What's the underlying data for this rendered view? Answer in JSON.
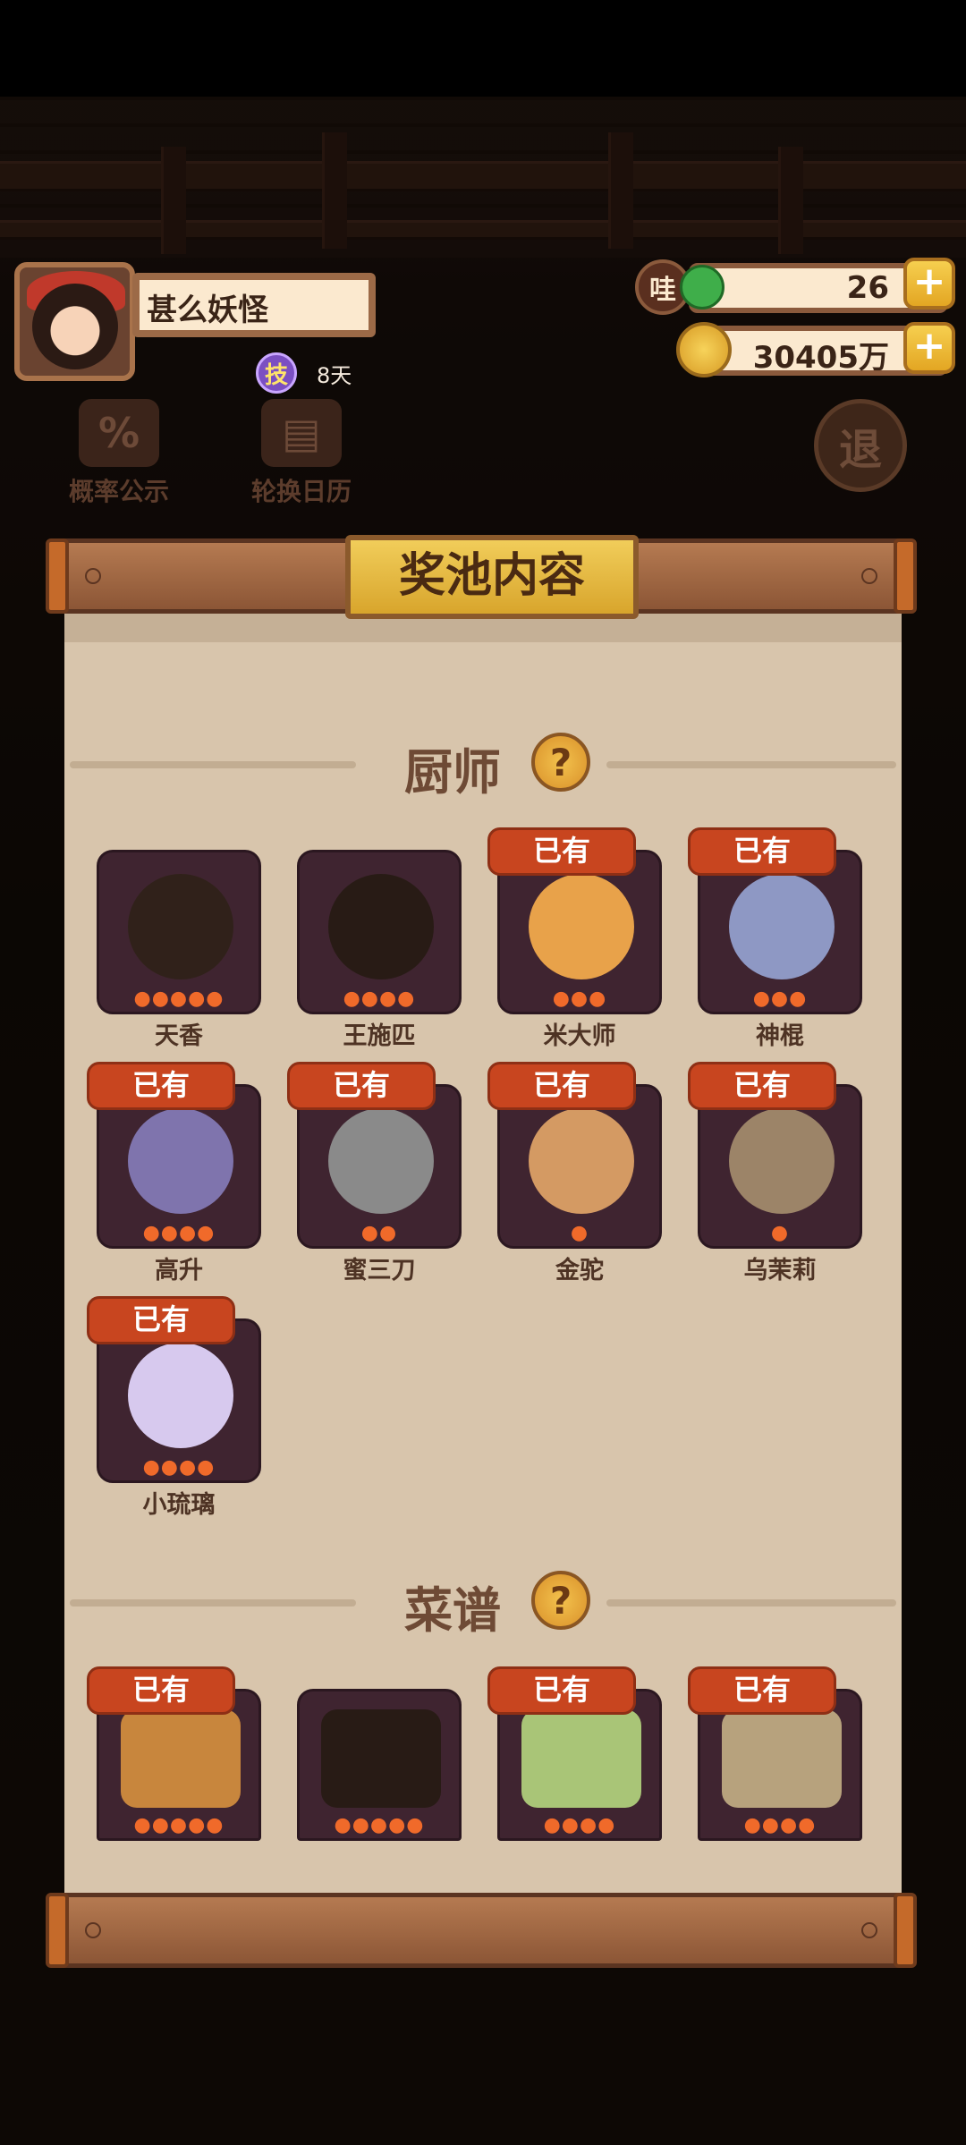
{
  "player": {
    "name": "甚么妖怪",
    "skill_badge": "技",
    "skill_days": "8天"
  },
  "currencies": [
    {
      "icon": "jade-token-icon",
      "icon_text": "哇",
      "value": "26"
    },
    {
      "icon": "gold-coin-icon",
      "icon_text": "",
      "value": "30405万"
    }
  ],
  "side_buttons": {
    "probability": "概率公示",
    "rotation_calendar": "轮换日历",
    "exit": "退"
  },
  "modal": {
    "title": "奖池内容",
    "owned_label": "已有",
    "sections": {
      "chefs_label": "厨师",
      "recipes_label": "菜谱"
    },
    "chefs": [
      {
        "name": "天香",
        "owned": false,
        "stars": 5,
        "color": "#6b4a3a"
      },
      {
        "name": "王施匹",
        "owned": false,
        "stars": 4,
        "color": "#5a3b2f"
      },
      {
        "name": "米大师",
        "owned": true,
        "stars": 3,
        "color": "#e8a24a"
      },
      {
        "name": "神棍",
        "owned": true,
        "stars": 3,
        "color": "#8e98c4"
      },
      {
        "name": "高升",
        "owned": true,
        "stars": 4,
        "color": "#7f74ad"
      },
      {
        "name": "蜜三刀",
        "owned": true,
        "stars": 2,
        "color": "#8a8a8a"
      },
      {
        "name": "金驼",
        "owned": true,
        "stars": 1,
        "color": "#d49a63"
      },
      {
        "name": "乌茉莉",
        "owned": true,
        "stars": 1,
        "color": "#9c8468"
      },
      {
        "name": "小琉璃",
        "owned": true,
        "stars": 4,
        "color": "#d7c9ee"
      }
    ],
    "recipes": [
      {
        "owned": true,
        "stars": 5,
        "color": "#c8863d"
      },
      {
        "owned": false,
        "stars": 5,
        "color": "#5a3c2e"
      },
      {
        "owned": true,
        "stars": 4,
        "color": "#a9c577"
      },
      {
        "owned": true,
        "stars": 4,
        "color": "#b7a27d"
      }
    ]
  }
}
